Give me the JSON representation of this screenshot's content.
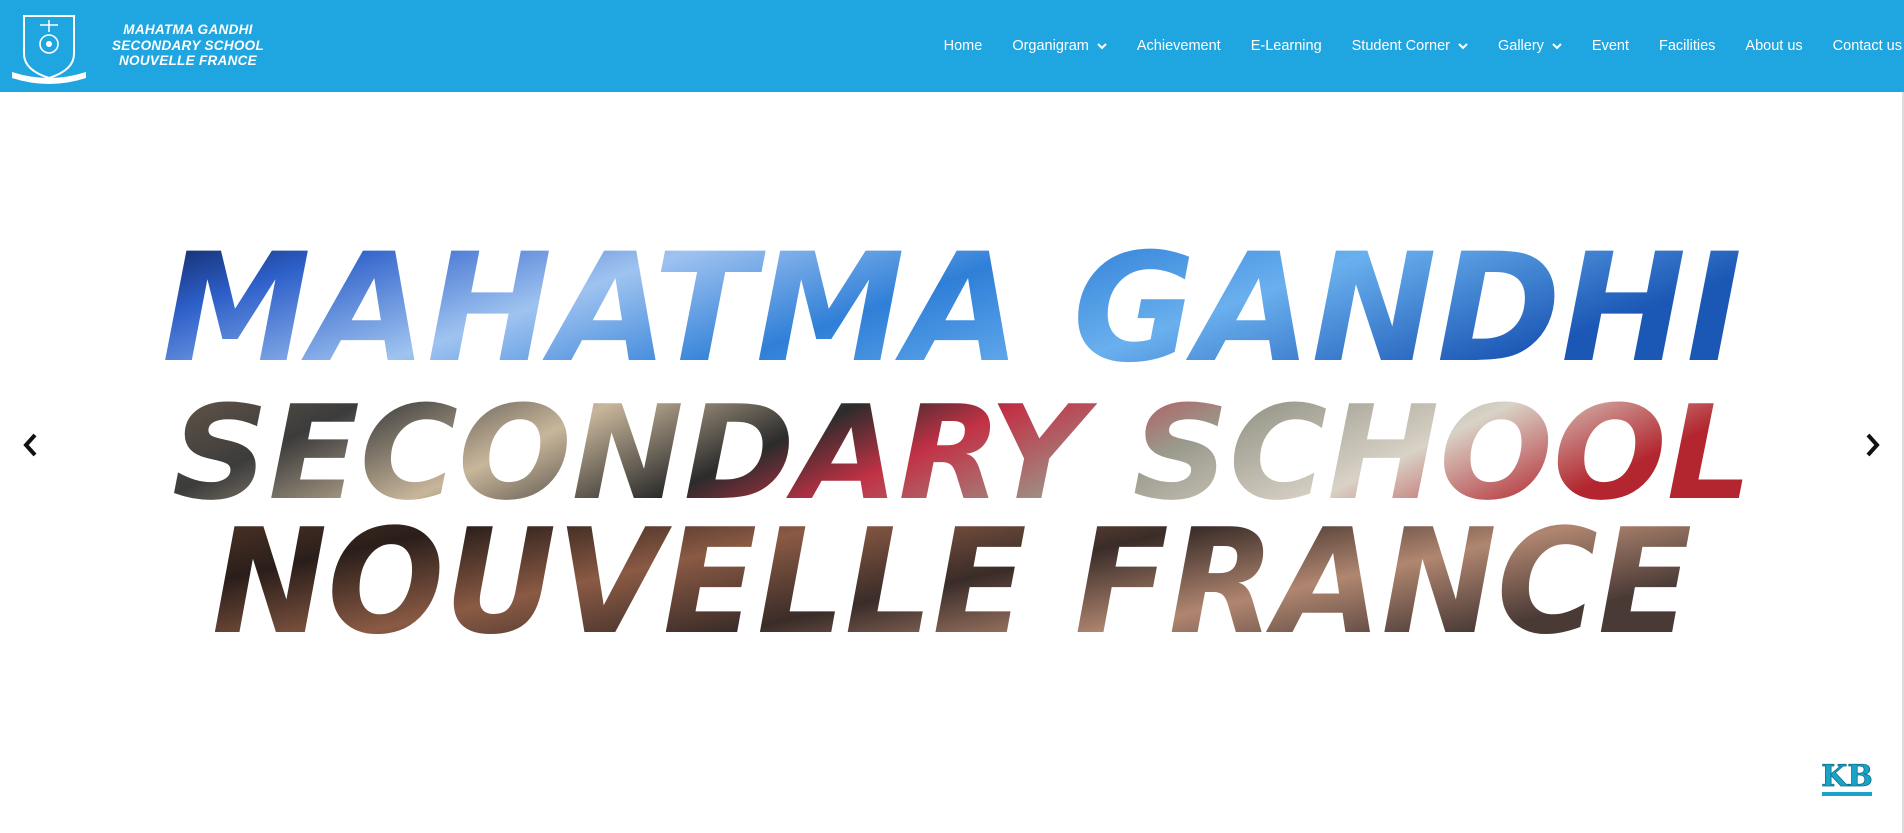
{
  "header": {
    "school_name_lines": [
      "MAHATMA GANDHI",
      "SECONDARY SCHOOL",
      "NOUVELLE FRANCE"
    ],
    "logo_icon": "school-crest-icon",
    "bg_color": "#1fa5df"
  },
  "nav": {
    "items": [
      {
        "label": "Home",
        "has_dropdown": false
      },
      {
        "label": "Organigram",
        "has_dropdown": true
      },
      {
        "label": "Achievement",
        "has_dropdown": false
      },
      {
        "label": "E-Learning",
        "has_dropdown": false
      },
      {
        "label": "Student Corner",
        "has_dropdown": true
      },
      {
        "label": "Gallery",
        "has_dropdown": true
      },
      {
        "label": "Event",
        "has_dropdown": false
      },
      {
        "label": "Facilities",
        "has_dropdown": false
      },
      {
        "label": "About us",
        "has_dropdown": false
      },
      {
        "label": "Contact us",
        "has_dropdown": false
      }
    ]
  },
  "hero": {
    "banner_lines": [
      "MAHATMA GANDHI",
      "SECONDARY SCHOOL",
      "NOUVELLE FRANCE"
    ],
    "prev_icon": "chevron-left-icon",
    "next_icon": "chevron-right-icon"
  },
  "badge": {
    "text": "KB",
    "icon": "kb-logo-icon",
    "color": "#1aa3c8"
  }
}
